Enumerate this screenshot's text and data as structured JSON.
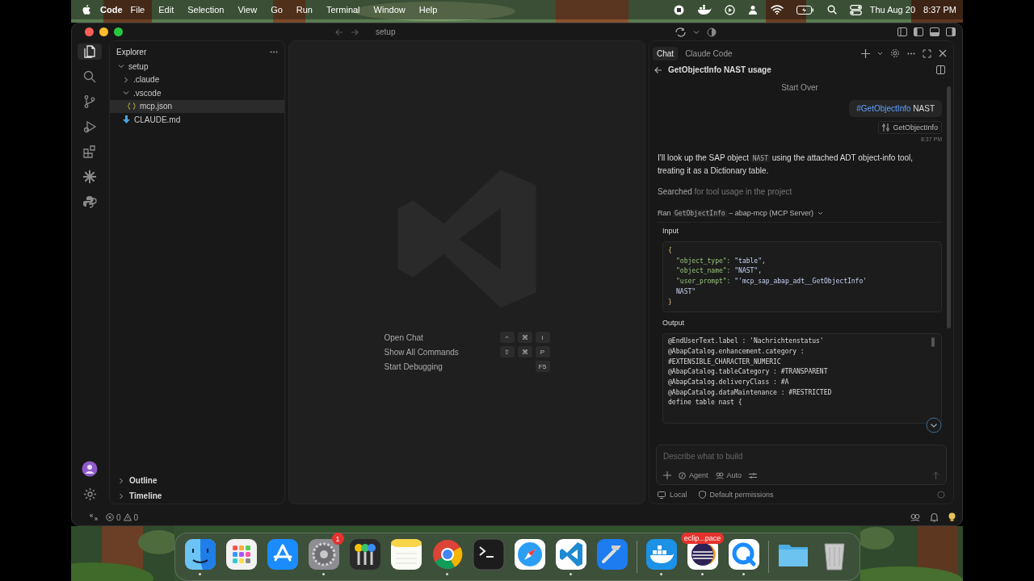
{
  "menubar": {
    "app": "Code",
    "menus": [
      "File",
      "Edit",
      "Selection",
      "View",
      "Go",
      "Run",
      "Terminal",
      "Window",
      "Help"
    ],
    "date": "Thu Aug 20",
    "time": "8:37 PM"
  },
  "titlebar": {
    "search": "setup"
  },
  "activity": [
    {
      "kind": "files",
      "selected": true
    },
    {
      "kind": "search",
      "selected": false
    },
    {
      "kind": "branch",
      "selected": false
    },
    {
      "kind": "debug",
      "selected": false
    },
    {
      "kind": "extensions",
      "selected": false
    },
    {
      "kind": "sparkle",
      "selected": false
    },
    {
      "kind": "python",
      "selected": false
    }
  ],
  "explorer": {
    "title": "Explorer",
    "tree": [
      {
        "label": "setup",
        "kind": "folder",
        "expanded": true,
        "selected": false,
        "children": [
          {
            "label": ".claude",
            "kind": "folder",
            "expanded": false,
            "selected": false
          },
          {
            "label": ".vscode",
            "kind": "folder",
            "expanded": true,
            "selected": false,
            "children": [
              {
                "label": "mcp.json",
                "kind": "json",
                "selected": true
              }
            ]
          },
          {
            "label": "CLAUDE.md",
            "kind": "markdown",
            "selected": false
          }
        ]
      }
    ],
    "sections": [
      {
        "label": "Outline",
        "expanded": false
      },
      {
        "label": "Timeline",
        "expanded": false
      }
    ]
  },
  "editor": {
    "shortcuts": [
      {
        "label": "Open Chat",
        "keys": [
          "^",
          "⌘",
          "I"
        ]
      },
      {
        "label": "Show All Commands",
        "keys": [
          "⇧",
          "⌘",
          "P"
        ]
      },
      {
        "label": "Start Debugging",
        "keys": [
          "F5"
        ]
      }
    ]
  },
  "chat": {
    "tabs": [
      {
        "label": "Chat",
        "selected": true
      },
      {
        "label": "Claude Code",
        "selected": false
      }
    ],
    "title": "GetObjectInfo NAST usage",
    "divider": "Start Over",
    "user": {
      "tag": "#GetObjectInfo",
      "text": "NAST",
      "attachment": "GetObjectInfo",
      "time": "8:37 PM"
    },
    "message": {
      "before": "I'll look up the SAP object ",
      "code": "NAST",
      "after": " using the attached ADT object-info tool, treating it as a Dictionary table."
    },
    "searched": {
      "verb": "Searched",
      "rest": "for tool usage in the project"
    },
    "ran": {
      "verb": "Ran",
      "tool": "GetObjectInfo",
      "rest": "– abap-mcp (MCP Server)"
    },
    "input": {
      "label": "Input",
      "lines": [
        {
          "kind": "brace",
          "text": "{"
        },
        {
          "kind": "pair",
          "key": "\"object_type\":",
          "value": "\"table\","
        },
        {
          "kind": "pair",
          "key": "\"object_name\":",
          "value": "\"NAST\","
        },
        {
          "kind": "pair",
          "key": "\"user_prompt\":",
          "value": "\"'mcp_sap_abap_adt__GetObjectInfo'"
        },
        {
          "kind": "cont",
          "text": "NAST\""
        },
        {
          "kind": "brace",
          "text": "}"
        }
      ]
    },
    "output": {
      "label": "Output",
      "lines": [
        "@EndUserText.label : 'Nachrichtenstatus'",
        "@AbapCatalog.enhancement.category :",
        "#EXTENSIBLE_CHARACTER_NUMERIC",
        "@AbapCatalog.tableCategory : #TRANSPARENT",
        "@AbapCatalog.deliveryClass : #A",
        "@AbapCatalog.dataMaintenance : #RESTRICTED",
        "define table nast {"
      ]
    },
    "composer": {
      "placeholder": "Describe what to build",
      "mode": "Agent",
      "model": "Auto"
    },
    "footer": {
      "location": "Local",
      "permissions": "Default permissions"
    }
  },
  "statusbar": {
    "errors": "0",
    "warnings": "0"
  },
  "dock": [
    {
      "kind": "finder",
      "running": true
    },
    {
      "kind": "launchpad",
      "running": false
    },
    {
      "kind": "appstore",
      "running": false
    },
    {
      "kind": "settings",
      "running": true,
      "badge": "1"
    },
    {
      "kind": "keychain",
      "running": false
    },
    {
      "kind": "notes",
      "running": false
    },
    {
      "kind": "chrome",
      "running": true
    },
    {
      "kind": "terminal",
      "running": false
    },
    {
      "kind": "safari",
      "running": false
    },
    {
      "kind": "vscode",
      "running": true
    },
    {
      "kind": "xcode",
      "running": false
    },
    {
      "kind": "separator"
    },
    {
      "kind": "docker",
      "running": true
    },
    {
      "kind": "eclipse",
      "running": true,
      "tooltip": "eclip...pace"
    },
    {
      "kind": "quicktime",
      "running": true
    },
    {
      "kind": "separator"
    },
    {
      "kind": "folder",
      "running": false
    },
    {
      "kind": "trash",
      "running": false
    }
  ]
}
